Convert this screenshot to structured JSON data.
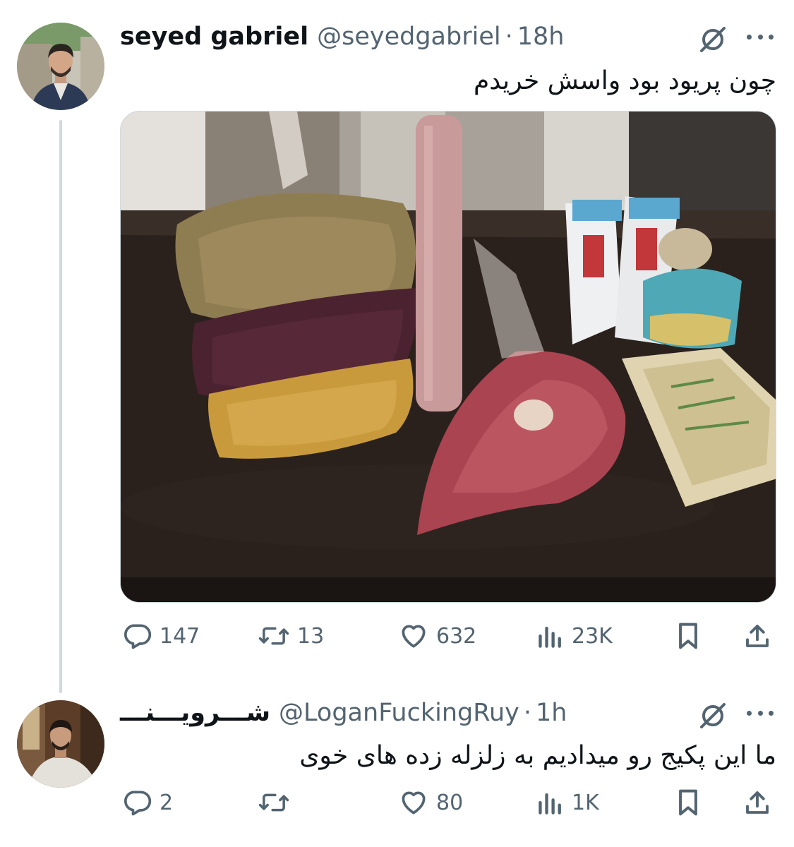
{
  "tweet": {
    "author_name": "seyed gabriel",
    "handle": "@seyedgabriel",
    "separator": "·",
    "time": "18h",
    "text": "چون پریود بود واسش خریدم",
    "actions": {
      "replies": "147",
      "retweets": "13",
      "likes": "632",
      "views": "23K"
    }
  },
  "reply": {
    "author_name": "شـــرویـــنـــ",
    "handle": "@LoganFuckingRuy",
    "separator": "·",
    "time": "1h",
    "text": "ما این پکیج رو میدادیم به زلزله زده های خوی",
    "actions": {
      "replies": "2",
      "retweets": "",
      "likes": "80",
      "views": "1K"
    }
  },
  "icons": {
    "reply": "speech-bubble-icon",
    "retweet": "retweet-arrows-icon",
    "like": "heart-icon",
    "views": "bar-chart-icon",
    "bookmark": "bookmark-icon",
    "share": "share-upload-icon",
    "grok": "grok-slash-circle-icon",
    "more": "more-dots-icon"
  },
  "colors": {
    "text_primary": "#0f1419",
    "text_secondary": "#536471",
    "thread_line": "#cfd9de"
  }
}
